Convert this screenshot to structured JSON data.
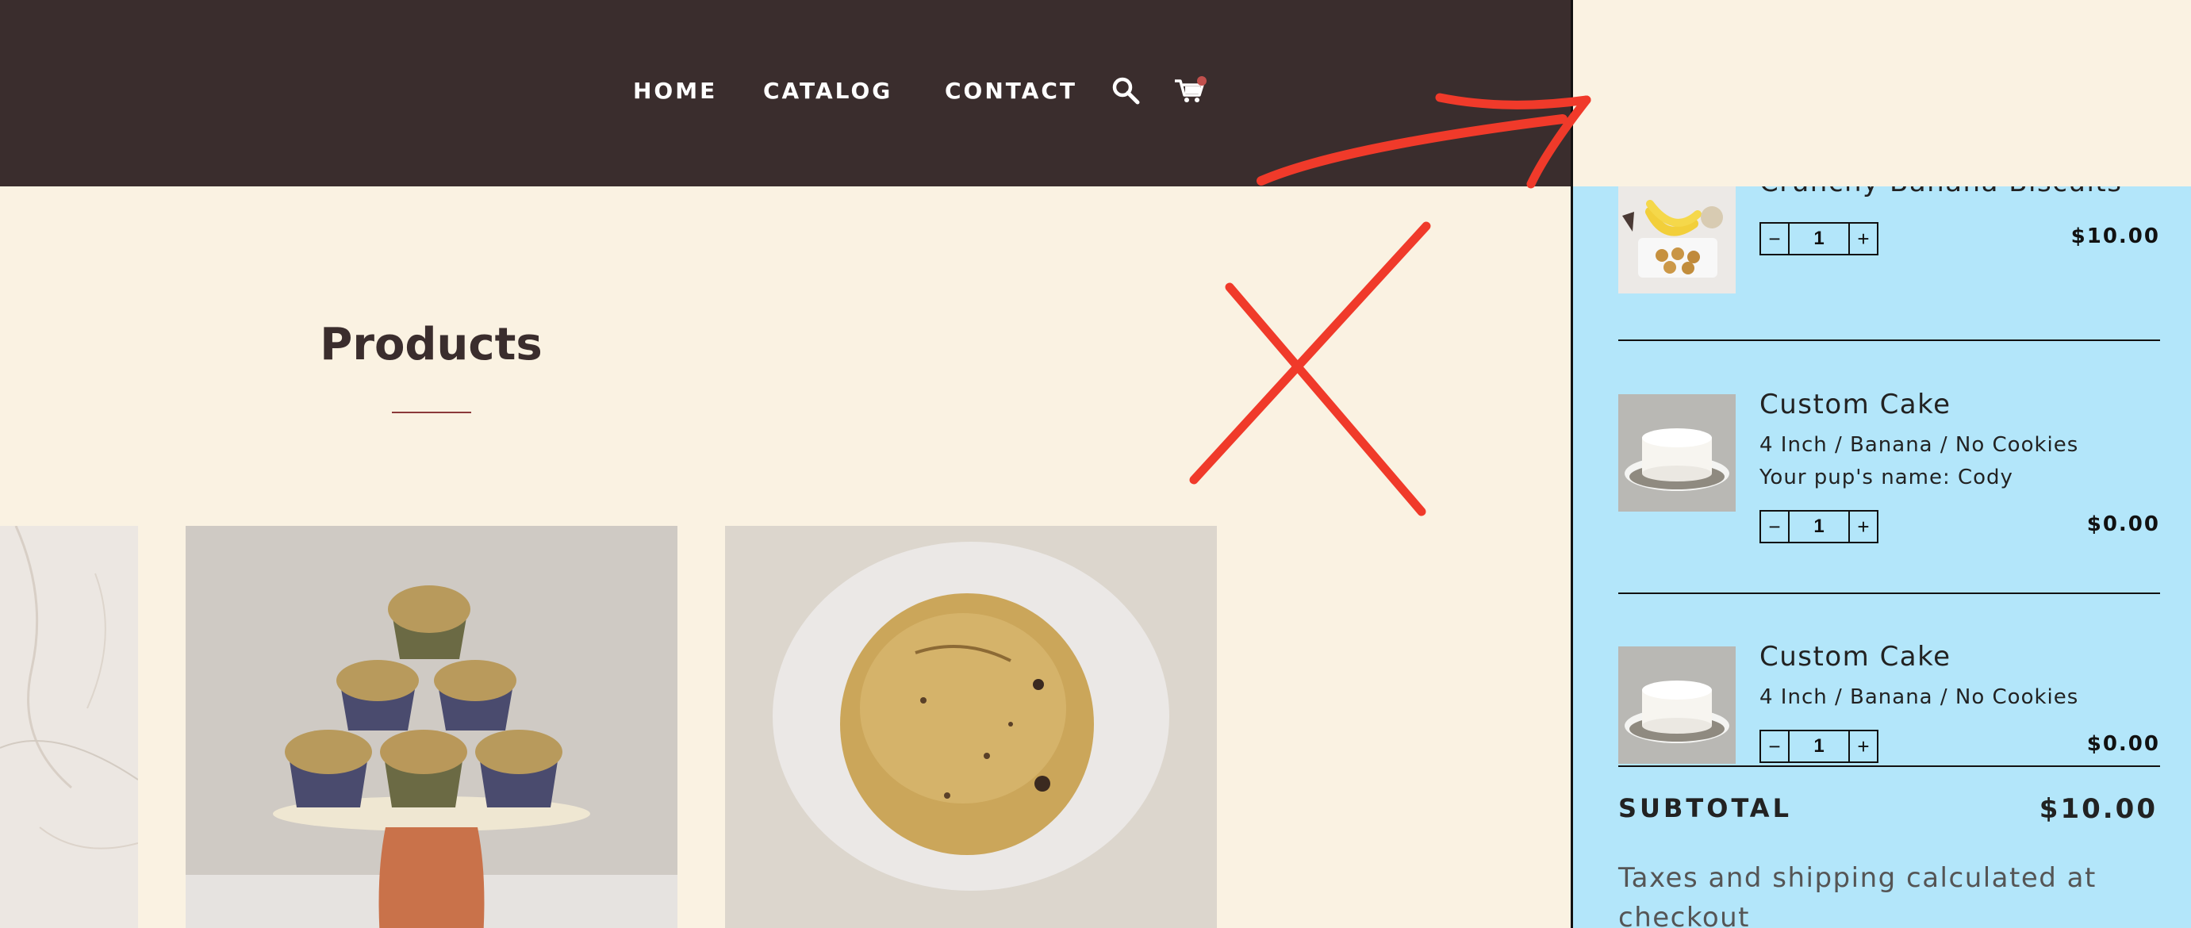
{
  "nav": {
    "links": [
      "HOME",
      "CATALOG",
      "CONTACT"
    ],
    "icons": [
      "search-icon",
      "cart-icon"
    ],
    "cart_badge_color": "#c0504d"
  },
  "page": {
    "title": "Products"
  },
  "products": [
    {
      "image": "marble-product-photo"
    },
    {
      "image": "stacked-muffins-photo"
    },
    {
      "image": "muffin-closeup-photo"
    }
  ],
  "cart": {
    "items": [
      {
        "title": "Crunchy Banana Biscuits",
        "meta": [],
        "qty": "1",
        "price": "$10.00"
      },
      {
        "title": "Custom Cake",
        "meta": [
          "4 Inch / Banana / No Cookies",
          "Your pup's name: Cody"
        ],
        "qty": "1",
        "price": "$0.00"
      },
      {
        "title": "Custom Cake",
        "meta": [
          "4 Inch / Banana / No Cookies"
        ],
        "qty": "1",
        "price": "$0.00"
      }
    ],
    "qty_minus": "−",
    "qty_plus": "+",
    "subtotal_label": "SUBTOTAL",
    "subtotal_value": "$10.00",
    "tax_note": "Taxes and shipping calculated at checkout"
  },
  "colors": {
    "header_bg": "#3a2d2d",
    "page_bg": "#faf2e2",
    "drawer_bg": "#b3e6fa",
    "annotation_red": "#f03a2a"
  }
}
